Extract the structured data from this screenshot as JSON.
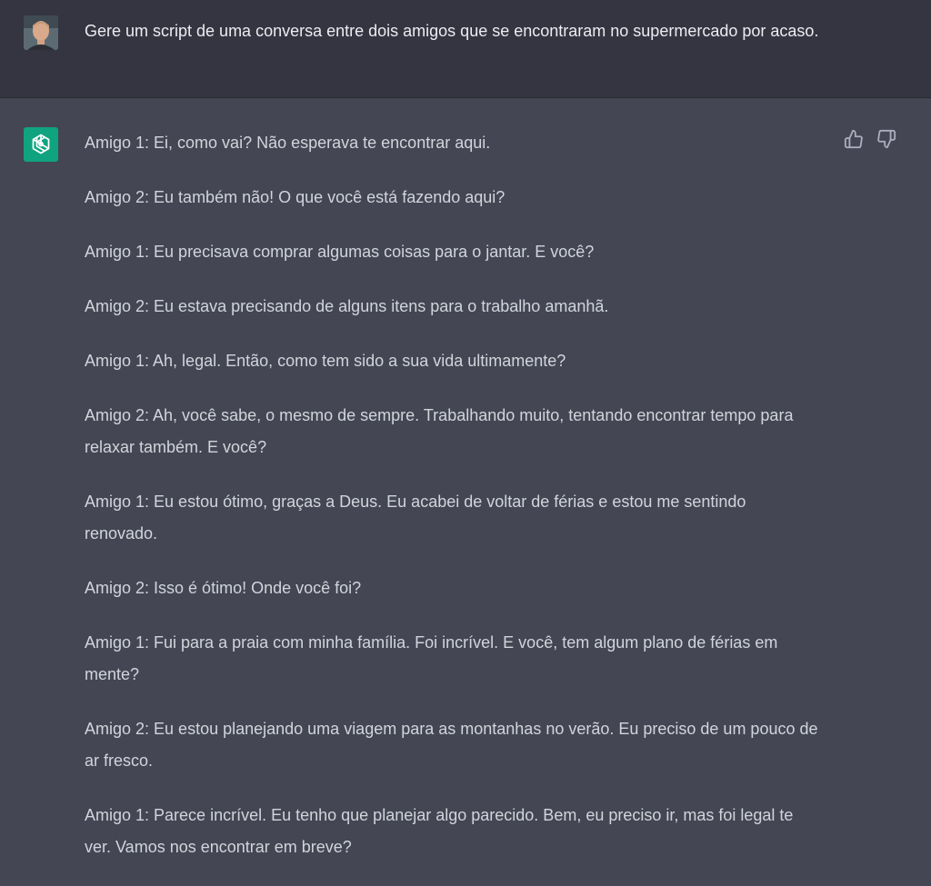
{
  "user": {
    "message": "Gere um script de uma conversa entre dois amigos que se encontraram no supermercado por acaso."
  },
  "assistant": {
    "messages": [
      "Amigo 1: Ei, como vai? Não esperava te encontrar aqui.",
      "Amigo 2: Eu também não! O que você está fazendo aqui?",
      "Amigo 1: Eu precisava comprar algumas coisas para o jantar. E você?",
      "Amigo 2: Eu estava precisando de alguns itens para o trabalho amanhã.",
      "Amigo 1: Ah, legal. Então, como tem sido a sua vida ultimamente?",
      "Amigo 2: Ah, você sabe, o mesmo de sempre. Trabalhando muito, tentando encontrar tempo para relaxar também. E você?",
      "Amigo 1: Eu estou ótimo, graças a Deus. Eu acabei de voltar de férias e estou me sentindo renovado.",
      "Amigo 2: Isso é ótimo! Onde você foi?",
      "Amigo 1: Fui para a praia com minha família. Foi incrível. E você, tem algum plano de férias em mente?",
      "Amigo 2: Eu estou planejando uma viagem para as montanhas no verão. Eu preciso de um pouco de ar fresco.",
      "Amigo 1: Parece incrível. Eu tenho que planejar algo parecido. Bem, eu preciso ir, mas foi legal te ver. Vamos nos encontrar em breve?"
    ]
  },
  "icons": {
    "user_avatar": "user-avatar",
    "assistant_avatar": "openai-logo-icon",
    "like": "thumbs-up-icon",
    "dislike": "thumbs-down-icon"
  },
  "colors": {
    "user_bg": "#343541",
    "assistant_bg": "#444654",
    "brand": "#10a37f"
  }
}
